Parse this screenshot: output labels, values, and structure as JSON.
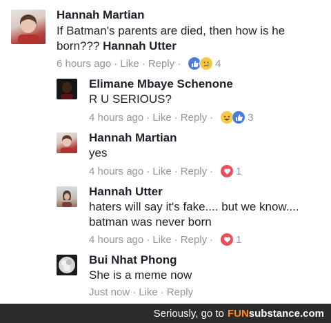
{
  "comments": [
    {
      "name": "Hannah Martian",
      "text": "If Batman's parents are died, then how is he",
      "text2": "born??? ",
      "tag": "Hannah Utter",
      "time": "6 hours ago",
      "like": "Like",
      "reply": "Reply",
      "reactions": [
        "like",
        "sad"
      ],
      "count": "4"
    },
    {
      "name": "Elimane Mbaye Schenone",
      "text": "R U SERIOUS?",
      "time": "4 hours ago",
      "like": "Like",
      "reply": "Reply",
      "reactions": [
        "haha",
        "like"
      ],
      "count": "3"
    },
    {
      "name": "Hannah Martian",
      "text": "yes",
      "time": "4 hours ago",
      "like": "Like",
      "reply": "Reply",
      "reactions": [
        "love"
      ],
      "count": "1"
    },
    {
      "name": "Hannah Utter",
      "text": "haters will say it's fake.... but we know....",
      "text2": "batman was never born",
      "time": "4 hours ago",
      "like": "Like",
      "reply": "Reply",
      "reactions": [
        "love"
      ],
      "count": "1"
    },
    {
      "name": "Bui Nhat Phong",
      "text": "She is a meme now",
      "time": "Just now",
      "like": "Like",
      "reply": "Reply"
    }
  ],
  "footer": {
    "prefix": "Seriously, go to",
    "brand_fun": "FUN",
    "brand_rest": "substance.com"
  },
  "colors": {
    "like": "#4a7dde",
    "love": "#e8505b",
    "emoji": "#f7c843",
    "meta": "#90949c"
  }
}
